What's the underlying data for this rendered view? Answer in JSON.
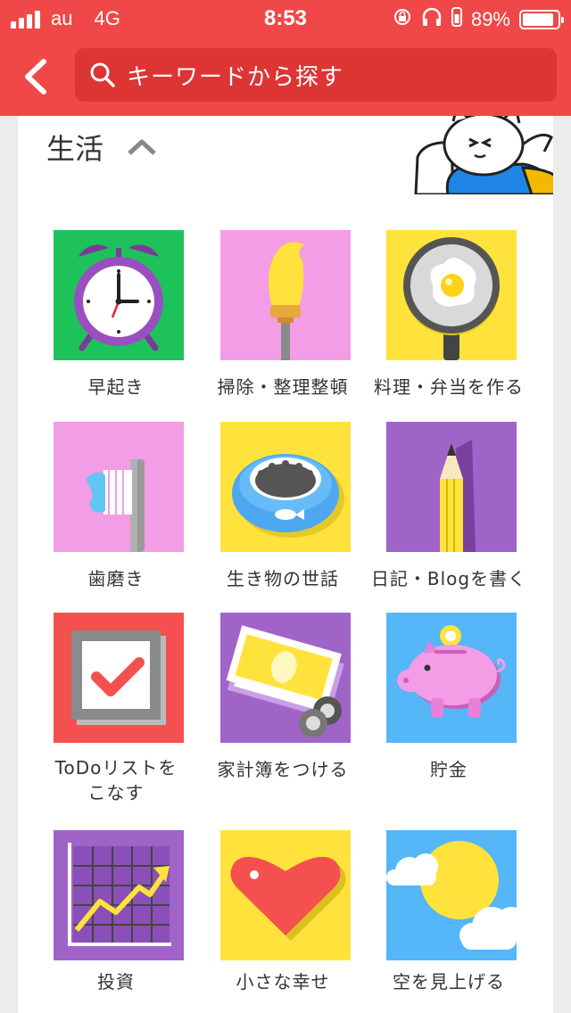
{
  "status": {
    "carrier": "au",
    "network": "4G",
    "time": "8:53",
    "battery": "89%",
    "battery_level": 0.89
  },
  "search": {
    "placeholder": "キーワードから探す"
  },
  "section": {
    "title": "生活"
  },
  "tiles": [
    {
      "label": "早起き",
      "icon": "alarm-clock-icon",
      "bg": "#1ec25a"
    },
    {
      "label": "掃除・整理整頓",
      "icon": "paintbrush-icon",
      "bg": "#f29de6"
    },
    {
      "label": "料理・弁当を作る",
      "icon": "frying-pan-egg-icon",
      "bg": "#ffe33c"
    },
    {
      "label": "歯磨き",
      "icon": "toothbrush-icon",
      "bg": "#f29de6"
    },
    {
      "label": "生き物の世話",
      "icon": "pet-bowl-icon",
      "bg": "#ffe33c"
    },
    {
      "label": "日記・Blogを書く",
      "icon": "pencil-icon",
      "bg": "#a064c8"
    },
    {
      "label": "ToDoリストを\nこなす",
      "icon": "checkbox-icon",
      "bg": "#f45050"
    },
    {
      "label": "家計簿をつける",
      "icon": "money-coins-icon",
      "bg": "#a064c8"
    },
    {
      "label": "貯金",
      "icon": "piggy-bank-icon",
      "bg": "#55b6f8"
    },
    {
      "label": "投資",
      "icon": "growth-chart-icon",
      "bg": "#a064c8"
    },
    {
      "label": "小さな幸せ",
      "icon": "heart-icon",
      "bg": "#ffe33c"
    },
    {
      "label": "空を見上げる",
      "icon": "sun-cloud-icon",
      "bg": "#55b6f8"
    }
  ]
}
